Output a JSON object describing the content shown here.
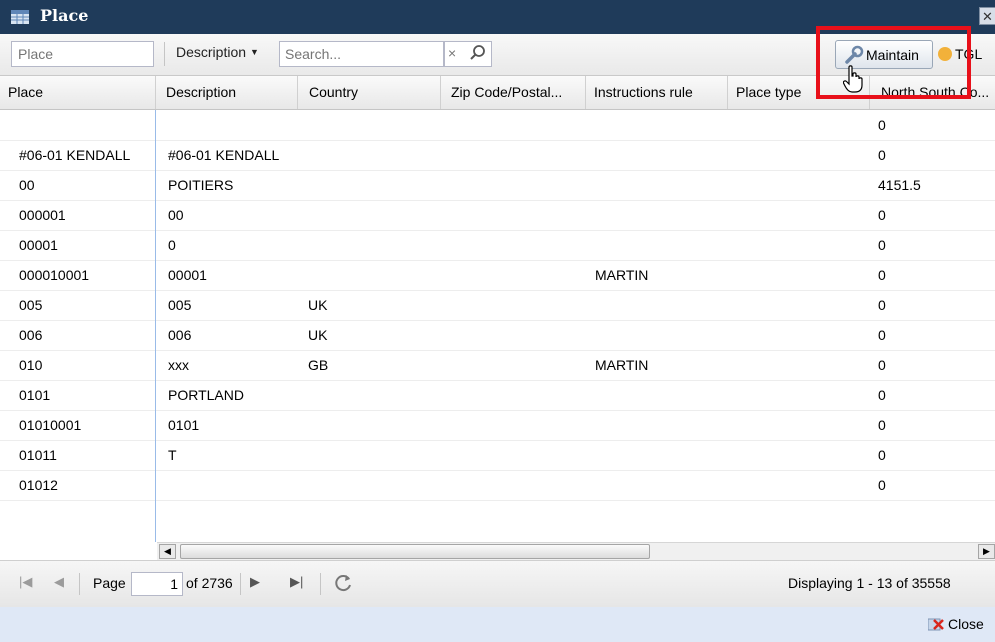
{
  "window": {
    "title": "Place"
  },
  "toolbar": {
    "place_placeholder": "Place",
    "description_label": "Description",
    "search_placeholder": "Search...",
    "clear_symbol": "×",
    "maintain_label": "Maintain",
    "tgl_label": "TGL"
  },
  "grid": {
    "columns": [
      "Place",
      "Description",
      "Country",
      "Zip Code/Postal...",
      "Instructions rule",
      "Place type",
      "North South Co..."
    ],
    "rows": [
      [
        "",
        "",
        "",
        "",
        "",
        "",
        "0"
      ],
      [
        "#06-01 KENDALL",
        "#06-01 KENDALL",
        "",
        "",
        "",
        "",
        "0"
      ],
      [
        "00",
        "POITIERS",
        "",
        "",
        "",
        "",
        "4151.5"
      ],
      [
        "000001",
        "00",
        "",
        "",
        "",
        "",
        "0"
      ],
      [
        "00001",
        "0",
        "",
        "",
        "",
        "",
        "0"
      ],
      [
        "000010001",
        "00001",
        "",
        "",
        "MARTIN",
        "",
        "0"
      ],
      [
        "005",
        "005",
        "UK",
        "",
        "",
        "",
        "0"
      ],
      [
        "006",
        "006",
        "UK",
        "",
        "",
        "",
        "0"
      ],
      [
        "010",
        "xxx",
        "GB",
        "",
        "MARTIN",
        "",
        "0"
      ],
      [
        "0101",
        "PORTLAND",
        "",
        "",
        "",
        "",
        "0"
      ],
      [
        "01010001",
        "0101",
        "",
        "",
        "",
        "",
        "0"
      ],
      [
        "01011",
        "T",
        "",
        "",
        "",
        "",
        "0"
      ],
      [
        "01012",
        "",
        "",
        "",
        "",
        "",
        "0"
      ]
    ]
  },
  "pager": {
    "page_label": "Page",
    "page_value": "1",
    "of_label": "of 2736",
    "displaying": "Displaying 1 - 13 of 35558"
  },
  "footer": {
    "close_label": "Close"
  },
  "colors": {
    "titlebar": "#1f3b5a",
    "highlight": "#e8101a",
    "footer": "#dfe8f6"
  }
}
